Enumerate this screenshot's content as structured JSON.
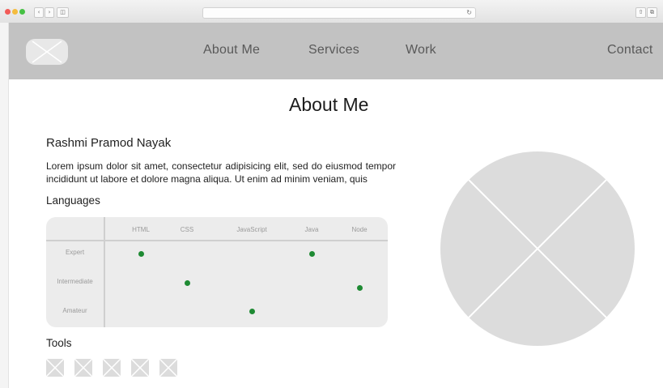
{
  "nav": {
    "links": [
      "About Me",
      "Services",
      "Work",
      "Contact"
    ]
  },
  "main": {
    "title": "About Me",
    "name": "Rashmi Pramod Nayak",
    "bio": "Lorem ipsum dolor sit amet, consectetur adipisicing elit, sed do eiusmod tempor incididunt ut labore et dolore magna aliqua. Ut enim ad minim veniam, quis",
    "languages_label": "Languages",
    "tools_label": "Tools"
  },
  "languages": {
    "columns": [
      "HTML",
      "CSS",
      "JavaScript",
      "Java",
      "Node"
    ],
    "levels": [
      "Expert",
      "Intermediate",
      "Amateur"
    ],
    "ratings": [
      {
        "language": "HTML",
        "level": "Expert"
      },
      {
        "language": "CSS",
        "level": "Intermediate"
      },
      {
        "language": "JavaScript",
        "level": "Amateur"
      },
      {
        "language": "Java",
        "level": "Expert"
      },
      {
        "language": "Node",
        "level": "Intermediate"
      }
    ]
  },
  "tools": {
    "count": 5
  },
  "colors": {
    "navbar": "#c2c2c2",
    "nav_text": "#595959",
    "dot": "#1e8a33",
    "placeholder": "#dcdcdc"
  }
}
